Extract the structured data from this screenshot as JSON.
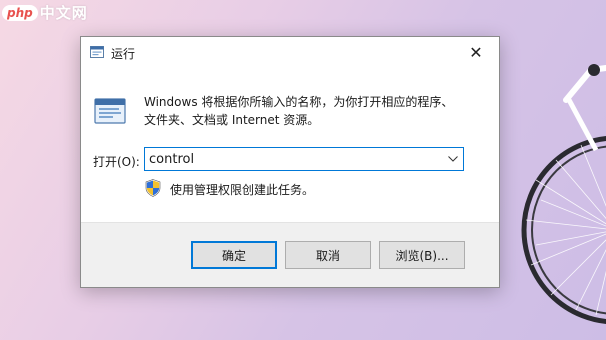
{
  "watermark": {
    "logo": "php",
    "text": "中文网"
  },
  "dialog": {
    "title": "运行",
    "close_glyph": "✕",
    "description_line1": "Windows 将根据你所输入的名称，为你打开相应的程序、",
    "description_line2": "文件夹、文档或 Internet 资源。",
    "open_label": "打开(O):",
    "open_value": "control",
    "admin_note": "使用管理权限创建此任务。",
    "buttons": {
      "ok": "确定",
      "cancel": "取消",
      "browse": "浏览(B)..."
    }
  },
  "icons": {
    "title": "run-app-icon",
    "main": "run-app-icon",
    "shield": "uac-shield-icon",
    "dropdown": "chevron-down-icon",
    "close": "close-icon"
  },
  "colors": {
    "accent": "#0078d7",
    "footer_bg": "#f0f0f0",
    "button_bg": "#e1e1e1"
  }
}
